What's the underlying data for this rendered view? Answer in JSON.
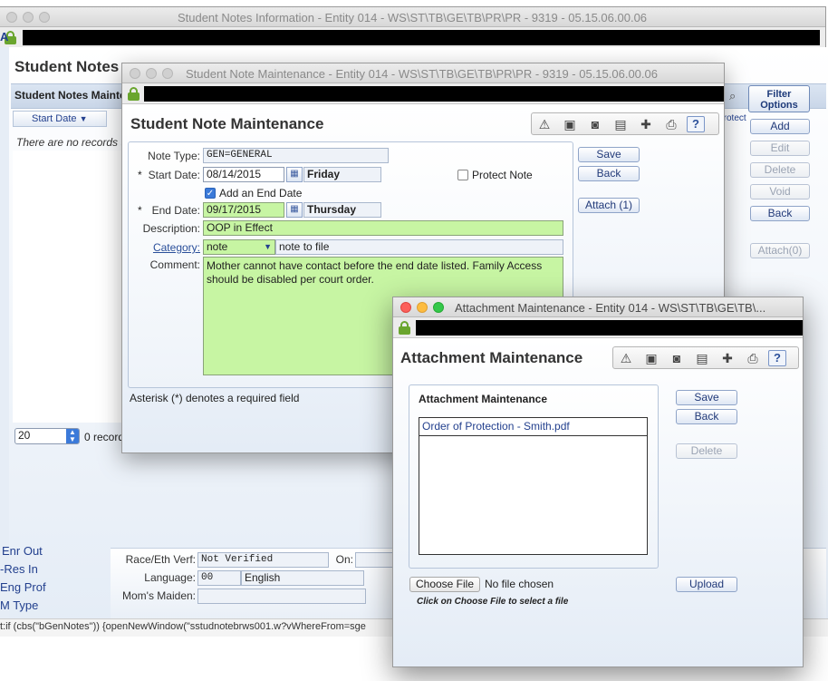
{
  "back_window": {
    "title": "Student Notes Information - Entity 014 - WS\\ST\\TB\\GE\\TB\\PR\\PR - 9319 - 05.15.06.00.06",
    "heading": "Student Notes Information",
    "sub_heading": "Student Notes Maintenance",
    "filter_options_label": "Filter Options",
    "column_start_date": "Start Date",
    "column_protect": "Protect",
    "empty_message": "There are no records to display",
    "page_size_value": "20",
    "record_count": "0 records",
    "actions": {
      "add": "Add",
      "edit": "Edit",
      "delete": "Delete",
      "void": "Void",
      "back": "Back",
      "attach": "Attach(0)"
    },
    "sidebar_links": [
      "Enr Out",
      "-Res In",
      "Eng Prof",
      "M Type"
    ],
    "race_eth_verf_label": "Race/Eth Verf:",
    "race_eth_verf_value": "Not Verified",
    "on_label": "On:",
    "language_label": "Language:",
    "language_code": "00",
    "language_name": "English",
    "moms_maiden_label": "Mom's Maiden:",
    "status_bar_text": "t:if (cbs(\"bGenNotes\")) {openNewWindow(\"sstudnotebrws001.w?vWhereFrom=sge"
  },
  "note_window": {
    "title": "Student Note Maintenance - Entity 014 - WS\\ST\\TB\\GE\\TB\\PR\\PR - 9319 - 05.15.06.00.06",
    "heading": "Student Note Maintenance",
    "note_type_label": "Note Type:",
    "note_type_value": "GEN=GENERAL",
    "start_date_label": "Start Date:",
    "start_date_value": "08/14/2015",
    "start_day": "Friday",
    "protect_note_label": "Protect Note",
    "add_end_date_label": "Add an End Date",
    "end_date_label": "End Date:",
    "end_date_value": "09/17/2015",
    "end_day": "Thursday",
    "description_label": "Description:",
    "description_value": "OOP in Effect",
    "category_label": "Category:",
    "category_value": "note",
    "category_desc": "note to file",
    "comment_label": "Comment:",
    "comment_value": "Mother cannot have contact before the end date listed. Family Access should be disabled per court order.",
    "required_note": "Asterisk (*) denotes a required field",
    "required_asterisk": "*",
    "buttons": {
      "save": "Save",
      "back": "Back",
      "attach": "Attach (1)"
    }
  },
  "attach_window": {
    "title": "Attachment Maintenance - Entity 014 - WS\\ST\\TB\\GE\\TB\\...",
    "heading": "Attachment Maintenance",
    "panel_title": "Attachment Maintenance",
    "files": [
      "Order of Protection - Smith.pdf"
    ],
    "choose_file_label": "Choose File",
    "no_file_text": "No file chosen",
    "hint": "Click on Choose File to select a file",
    "buttons": {
      "save": "Save",
      "back": "Back",
      "delete": "Delete",
      "upload": "Upload"
    }
  },
  "colors": {
    "required_green": "#c7f5a3",
    "link_blue": "#2a4f9a",
    "accent_blue": "#23408e"
  },
  "icons": [
    "pointer-icon",
    "monitor-icon",
    "camera-icon",
    "notes-icon",
    "new-note-icon",
    "print-icon",
    "help-icon",
    "search-icon",
    "lock-icon",
    "calendar-icon",
    "chevron-down-icon"
  ]
}
